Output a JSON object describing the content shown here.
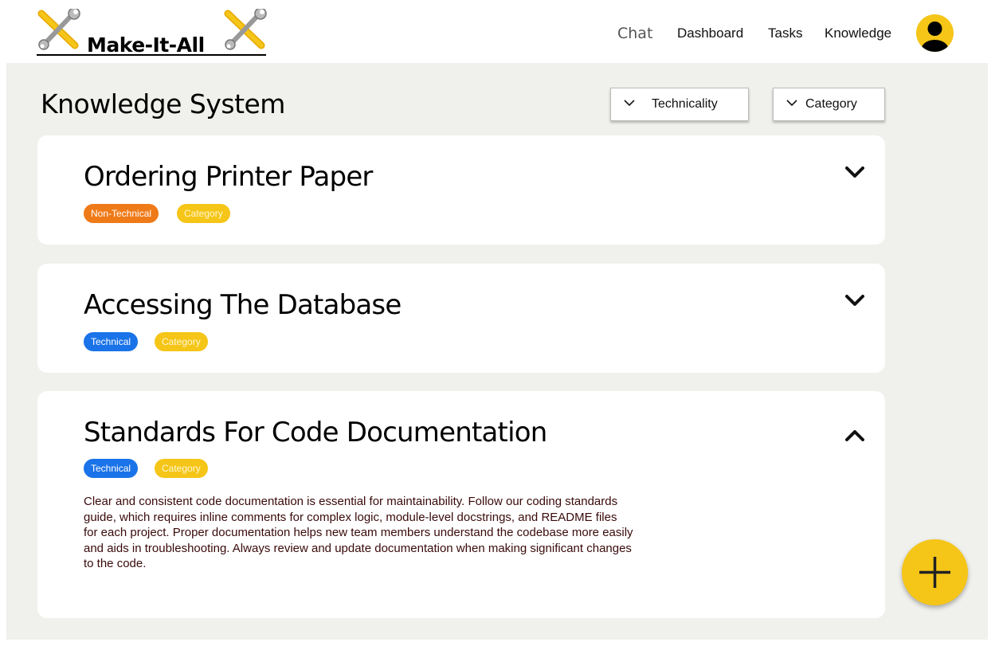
{
  "header": {
    "logo_text": "Make-It-All",
    "nav": {
      "chat": "Chat",
      "dashboard": "Dashboard",
      "tasks": "Tasks",
      "knowledge": "Knowledge"
    },
    "avatar_icon": "user-avatar-icon"
  },
  "page": {
    "title": "Knowledge System"
  },
  "filters": {
    "technicality_label": "Technicality",
    "category_label": "Category"
  },
  "articles": [
    {
      "title": "Ordering Printer Paper",
      "technicality": "Non-Technical",
      "category": "Category",
      "expanded": false
    },
    {
      "title": "Accessing The Database",
      "technicality": "Technical",
      "category": "Category",
      "expanded": false
    },
    {
      "title": "Standards For Code Documentation",
      "technicality": "Technical",
      "category": "Category",
      "expanded": true,
      "body": "Clear and consistent code documentation is essential for maintainability. Follow our coding standards guide, which requires inline comments for complex logic, module-level docstrings, and README files for each project. Proper documentation helps new team members understand the codebase more easily and aids in troubleshooting. Always review and update documentation when making significant changes to the code."
    }
  ],
  "fab": {
    "icon": "plus-icon"
  },
  "colors": {
    "brand_yellow": "#f5c518",
    "non_technical_tag": "#ef7a18",
    "technical_tag": "#1a73e8",
    "background": "#f0f0ec"
  }
}
